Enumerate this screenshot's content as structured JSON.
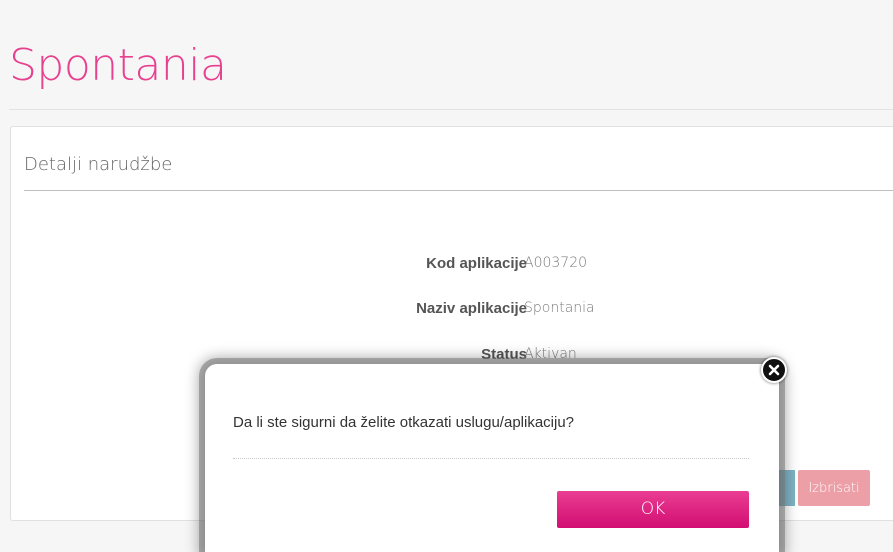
{
  "page": {
    "title": "Spontania"
  },
  "panel": {
    "heading": "Detalji narudžbe",
    "details": [
      {
        "label": "Kod aplikacije",
        "value": "A003720"
      },
      {
        "label": "Naziv aplikacije",
        "value": "Spontania"
      },
      {
        "label": "Status",
        "value": "Aktivan"
      }
    ],
    "delete_label": "Izbrisati"
  },
  "modal": {
    "message": "Da li ste sigurni da želite otkazati uslugu/aplikaciju?",
    "ok_label": "OK",
    "close_icon": "close-icon"
  },
  "colors": {
    "brand_pink": "#e7408e",
    "ok_button": "#d20e72",
    "delete_button": "#ec9fa6"
  }
}
